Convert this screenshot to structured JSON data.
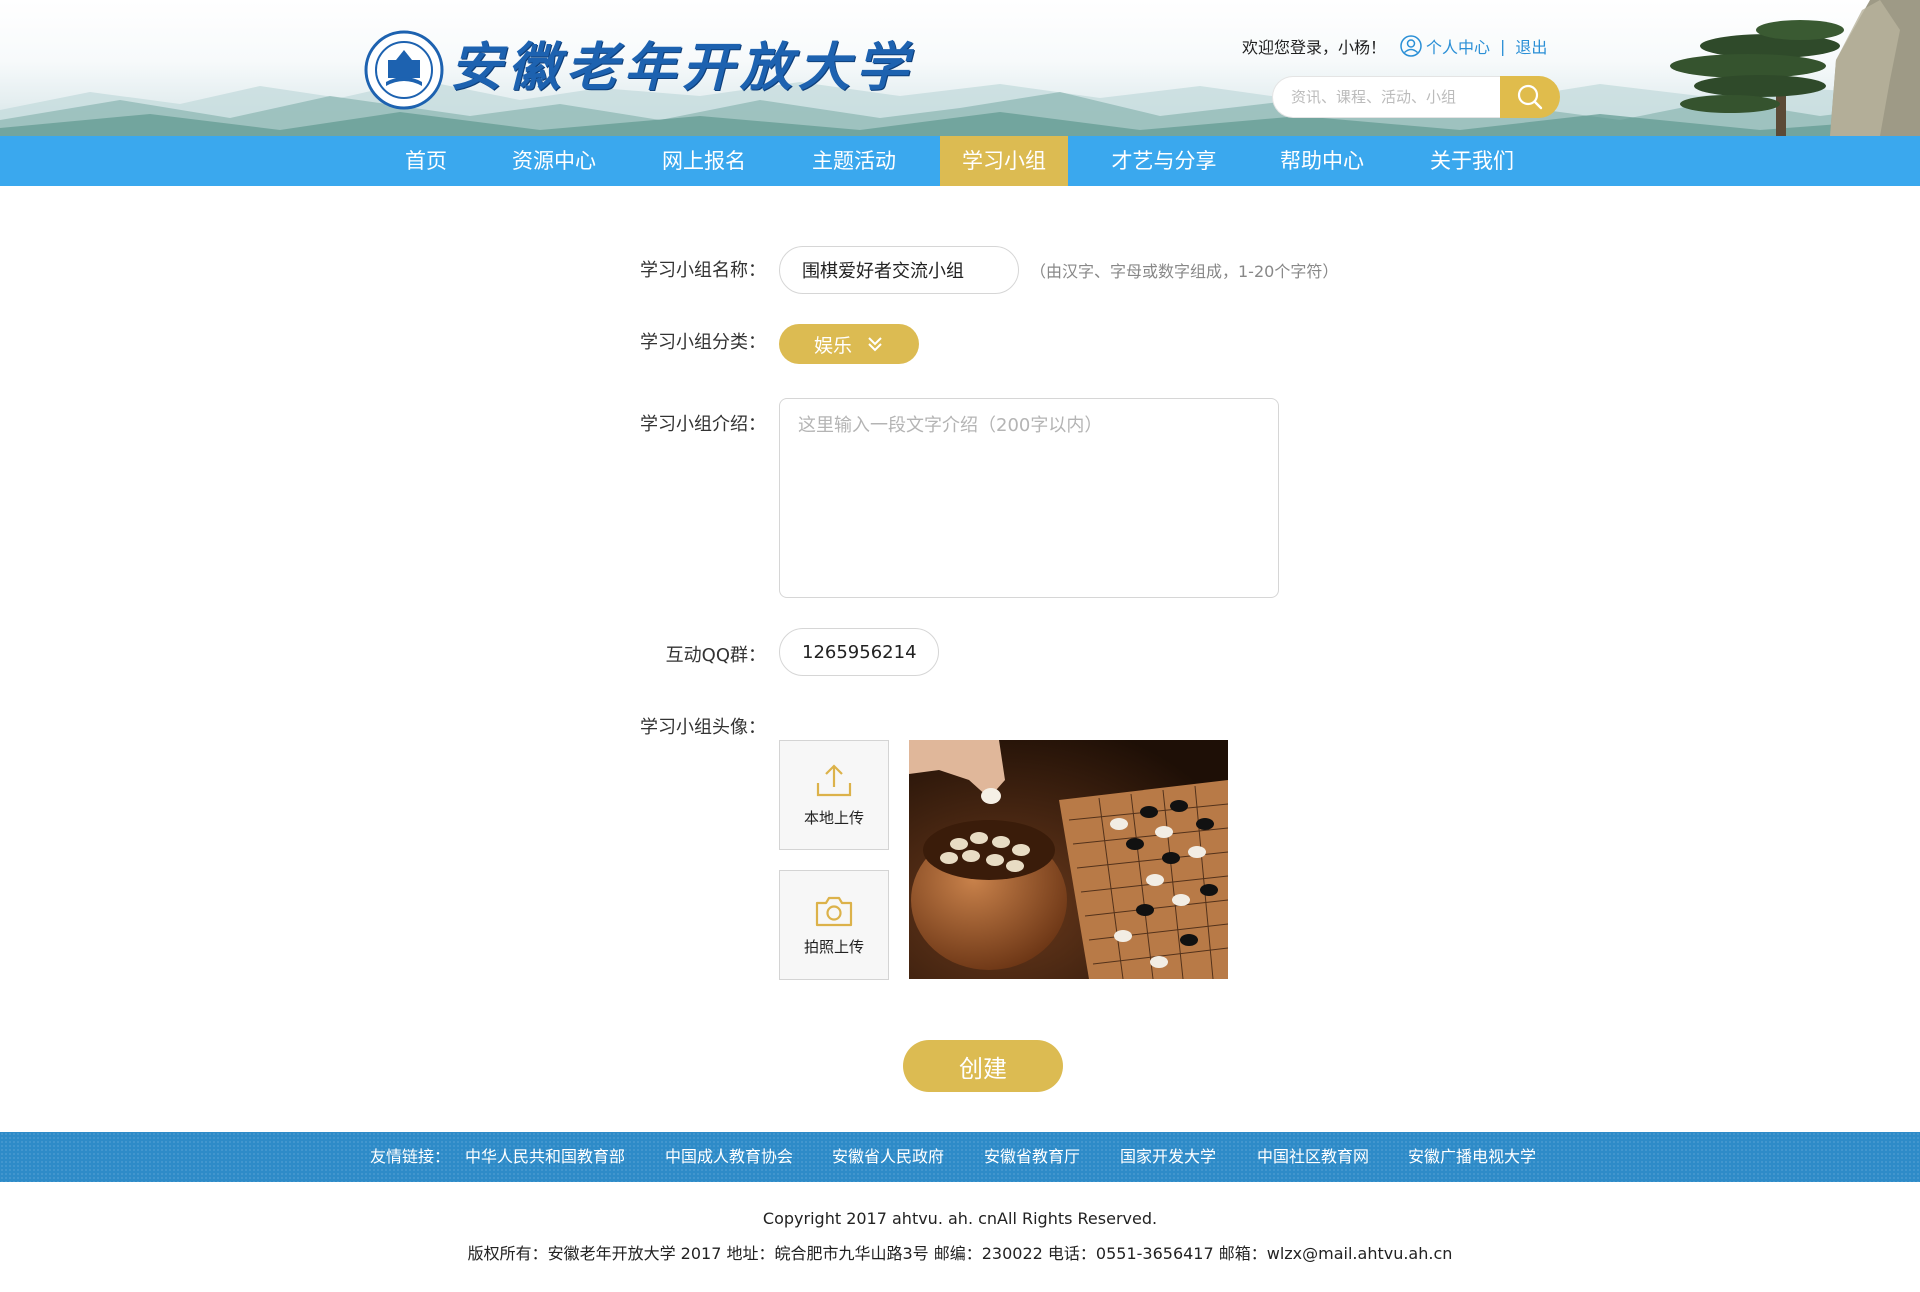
{
  "header": {
    "logo_text": "安徽老年开放大学",
    "welcome": "欢迎您登录，小杨！",
    "profile_link": "个人中心",
    "separator": "|",
    "logout_link": "退出",
    "search_placeholder": "资讯、课程、活动、小组"
  },
  "nav": {
    "items": [
      "首页",
      "资源中心",
      "网上报名",
      "主题活动",
      "学习小组",
      "才艺与分享",
      "帮助中心",
      "关于我们"
    ],
    "active": "学习小组"
  },
  "form": {
    "name_label": "学习小组名称：",
    "name_value": "围棋爱好者交流小组",
    "name_hint": "（由汉字、字母或数字组成，1-20个字符）",
    "category_label": "学习小组分类：",
    "category_value": "娱乐",
    "intro_label": "学习小组介绍：",
    "intro_placeholder": "这里输入一段文字介绍（200字以内）",
    "qq_label": "互动QQ群：",
    "qq_value": "1265956214",
    "avatar_label": "学习小组头像：",
    "upload_local": "本地上传",
    "upload_camera": "拍照上传",
    "submit": "创建"
  },
  "footer": {
    "links_label": "友情链接：",
    "links": [
      "中华人民共和国教育部",
      "中国成人教育协会",
      "安徽省人民政府",
      "安徽省教育厅",
      "国家开发大学",
      "中国社区教育网",
      "安徽广播电视大学"
    ],
    "copyright_line1": "Copyright 2017 ahtvu. ah. cnAll Rights Reserved.",
    "copyright_line2": "版权所有：安徽老年开放大学 2017 地址：皖合肥市九华山路3号 邮编：230022 电话：0551-3656417 邮箱：wlzx@mail.ahtvu.ah.cn"
  },
  "colors": {
    "nav_blue": "#3aa8ee",
    "accent_gold": "#dcbb52",
    "footer_blue": "#2e8bc8",
    "link_blue": "#2a8fd6"
  },
  "icons": {
    "search": "search-icon",
    "user": "user-icon",
    "dropdown": "chevron-down-double-icon",
    "upload": "upload-icon",
    "camera": "camera-icon"
  }
}
